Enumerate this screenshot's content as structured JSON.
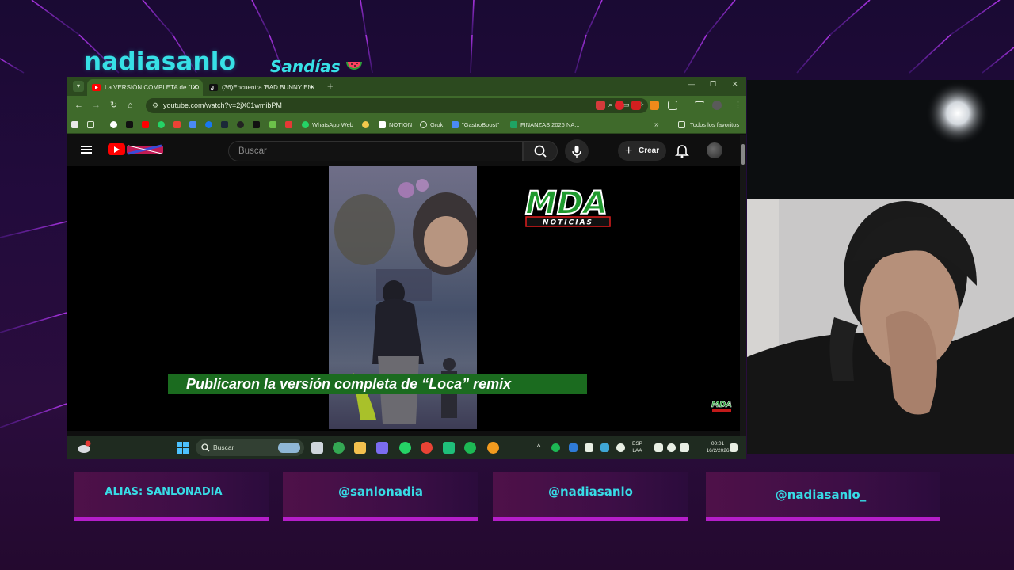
{
  "overlay": {
    "channel_name": "nadiasanlo",
    "subtitle": "Sandías",
    "social": [
      "ALIAS: SANLONADIA",
      "@sanlonadia",
      "@nadiasanlo",
      "@nadiasanlo_"
    ]
  },
  "browser": {
    "tabs": [
      {
        "title": "La VERSIÓN COMPLETA de \"LO",
        "active": true,
        "icon": "youtube-icon"
      },
      {
        "title": "(36)Encuentra 'BAD BUNNY EN",
        "active": false,
        "icon": "tiktok-icon"
      }
    ],
    "url": "youtube.com/watch?v=2jX01wmibPM",
    "bookmarks": [
      {
        "label": "WhatsApp Web",
        "icon": "whatsapp-icon"
      },
      {
        "label": "NOTION",
        "icon": "notion-icon"
      },
      {
        "label": "Grok",
        "icon": "grok-icon"
      },
      {
        "label": "\"GastroBoost\"",
        "icon": "doc-icon"
      },
      {
        "label": "FINANZAS 2026 NA...",
        "icon": "sheets-icon"
      }
    ],
    "all_bookmarks": "Todos los favoritos"
  },
  "youtube": {
    "search_placeholder": "Buscar",
    "create_label": "Crear",
    "caption": "Publicaron la versión completa de “Loca” remix",
    "logo_text_top": "MDA",
    "logo_text_bottom": "NOTICIAS",
    "logo_small": "MDA"
  },
  "taskbar": {
    "search_placeholder": "Buscar",
    "lang_top": "ESP",
    "lang_bottom": "LAA",
    "time": "00:01",
    "date": "16/2/2026"
  },
  "colors": {
    "accent_cyan": "#37e0e6",
    "browser_green": "#3f6a2b",
    "caption_green": "#1b6b1f",
    "youtube_red": "#ff0000",
    "neon_magenta": "#b51ec9"
  }
}
